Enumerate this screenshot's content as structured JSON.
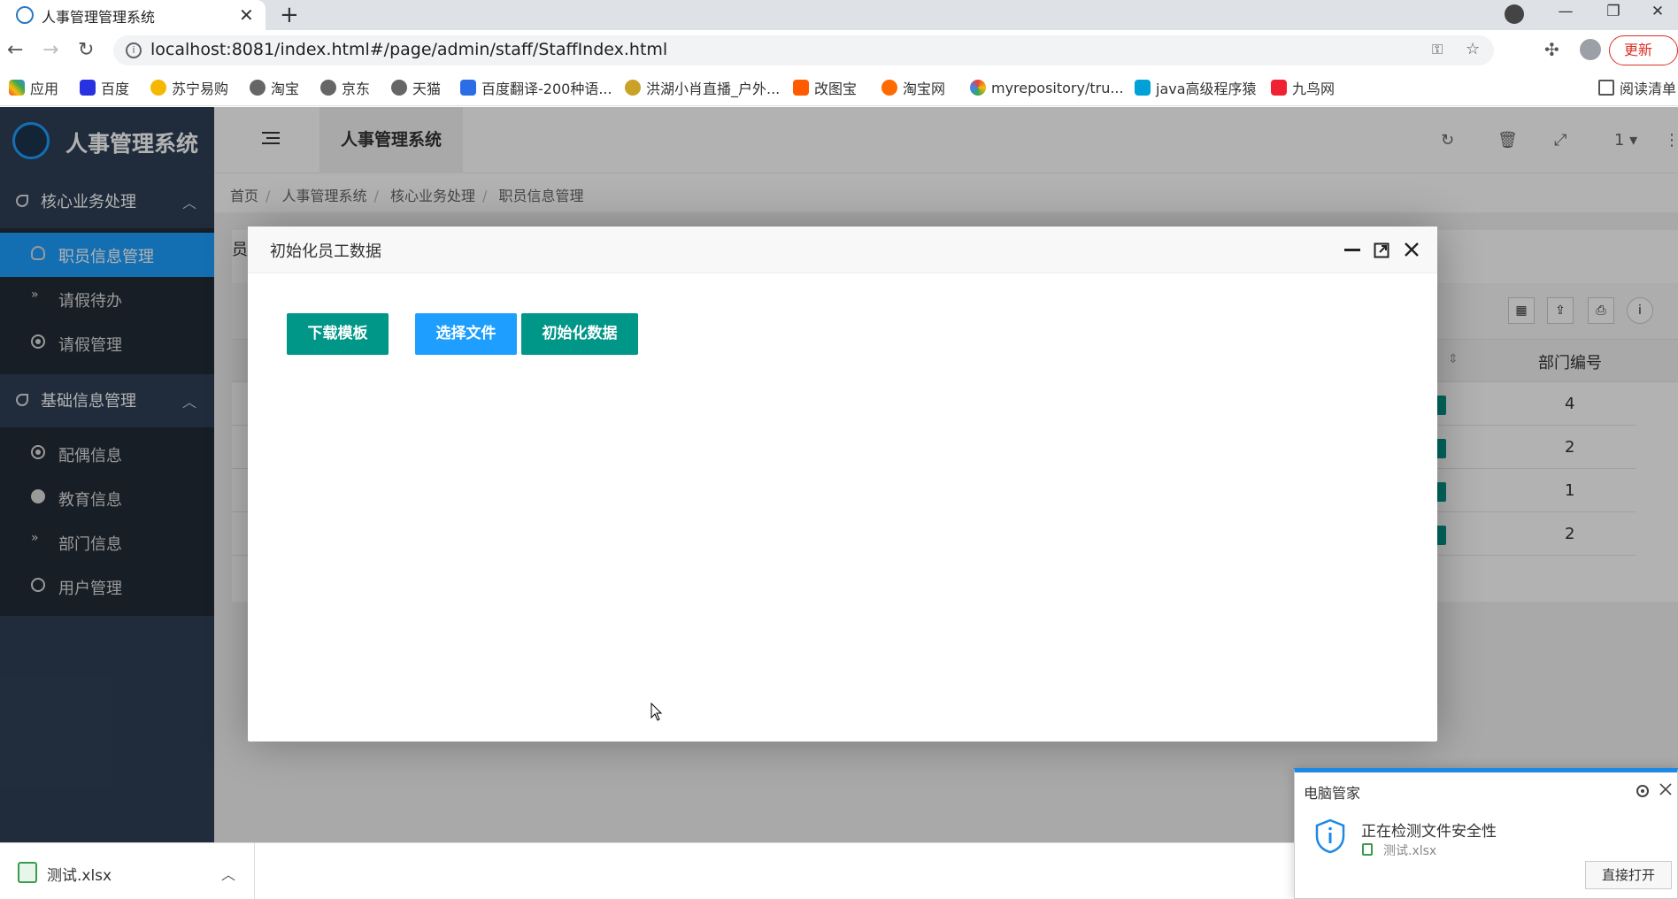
{
  "browser": {
    "tab_title": "人事管理管理系统",
    "url": "localhost:8081/index.html#/page/admin/staff/StaffIndex.html",
    "update_label": "更新",
    "bookmarks": [
      "应用",
      "百度",
      "苏宁易购",
      "淘宝",
      "京东",
      "天猫",
      "百度翻译-200种语...",
      "洪湖小肖直播_户外...",
      "改图宝",
      "淘宝网",
      "myrepository/tru...",
      "java高级程序猿",
      "九鸟网",
      "阅读清单"
    ]
  },
  "app": {
    "logo_text": "人事管理系统",
    "top_tab": "人事管理系统",
    "top_right_num": "1",
    "breadcrumb": [
      "首页",
      "人事管理系统",
      "核心业务处理",
      "职员信息管理"
    ]
  },
  "sidebar": {
    "group1": "核心业务处理",
    "group1_items": [
      "职员信息管理",
      "请假待办",
      "请假管理"
    ],
    "group2": "基础信息管理",
    "group2_items": [
      "配偶信息",
      "教育信息",
      "部门信息",
      "用户管理"
    ]
  },
  "table": {
    "card_title": "员",
    "dept_header": "部门编号",
    "dept_values": [
      "4",
      "2",
      "1",
      "2"
    ]
  },
  "modal": {
    "title": "初始化员工数据",
    "btn_download": "下载模板",
    "btn_select": "选择文件",
    "btn_init": "初始化数据"
  },
  "download": {
    "file": "测试.xlsx"
  },
  "toast": {
    "title": "电脑管家",
    "message": "正在检测文件安全性",
    "file": "测试.xlsx",
    "button": "直接打开"
  },
  "colors": {
    "sidebar": "#2f4056",
    "active": "#1e9fff",
    "teal": "#009688"
  }
}
